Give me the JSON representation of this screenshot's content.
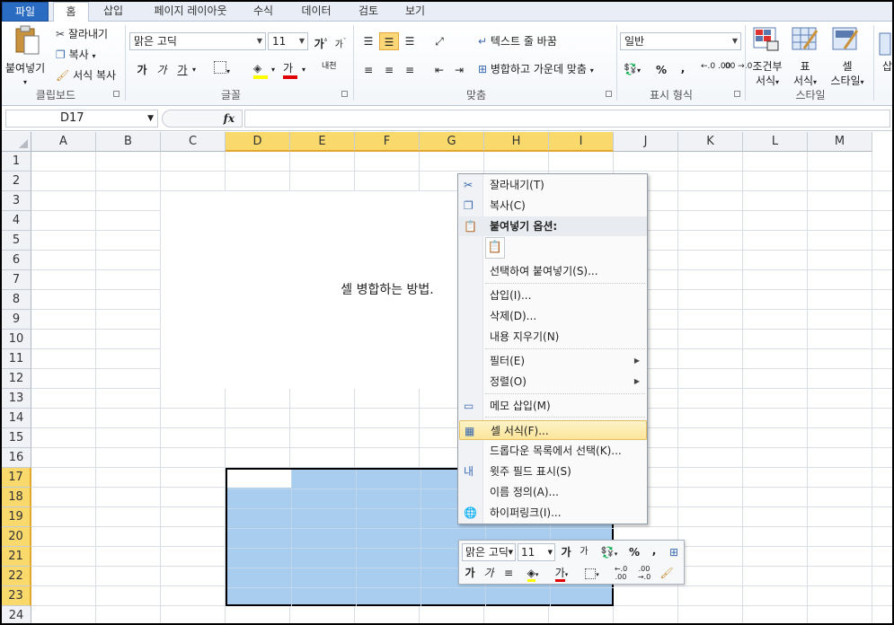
{
  "tabs": [
    "파일",
    "홈",
    "삽입",
    "페이지 레이아웃",
    "수식",
    "데이터",
    "검토",
    "보기"
  ],
  "ribbon": {
    "clipboard": {
      "paste": "붙여넣기",
      "cut": "잘라내기",
      "copy": "복사",
      "format_painter": "서식 복사",
      "group": "클립보드"
    },
    "font": {
      "name": "맑은 고딕",
      "size": "11",
      "grow": "가",
      "shrink": "가",
      "bold": "가",
      "italic": "가",
      "underline": "가",
      "color_a": "가",
      "phonetic": "내천",
      "group": "글꼴"
    },
    "alignment": {
      "wrap": "텍스트 줄 바꿈",
      "merge": "병합하고 가운데 맞춤",
      "group": "맞춤"
    },
    "number": {
      "format": "일반",
      "percent": "%",
      "comma": ",",
      "inc": "←.0 .00",
      "dec": ".00 →.0",
      "group": "표시 형식"
    },
    "styles": {
      "conditional_1": "조건부",
      "conditional_2": "서식",
      "table_1": "표",
      "table_2": "서식",
      "cell_1": "셀",
      "cell_2": "스타일",
      "group": "스타일"
    },
    "cells": {
      "insert": "삽"
    }
  },
  "formula_bar": {
    "name_box": "D17",
    "fx": "fx",
    "value": ""
  },
  "sheet": {
    "columns": [
      "A",
      "B",
      "C",
      "D",
      "E",
      "F",
      "G",
      "H",
      "I",
      "J",
      "K",
      "L",
      "M"
    ],
    "rows": [
      "1",
      "2",
      "3",
      "4",
      "5",
      "6",
      "7",
      "8",
      "9",
      "10",
      "11",
      "12",
      "13",
      "14",
      "15",
      "16",
      "17",
      "18",
      "19",
      "20",
      "21",
      "22",
      "23",
      "24"
    ],
    "merged_text": "셀 병합하는 방법."
  },
  "context_menu": {
    "items": [
      {
        "label": "잘라내기(T)",
        "icon": "scissors-icon"
      },
      {
        "label": "복사(C)",
        "icon": "copy-icon"
      },
      {
        "label": "붙여넣기 옵션:",
        "icon": "paste-icon"
      },
      {
        "label": "선택하여 붙여넣기(S)...",
        "icon": ""
      },
      {
        "label": "삽입(I)...",
        "icon": ""
      },
      {
        "label": "삭제(D)...",
        "icon": ""
      },
      {
        "label": "내용 지우기(N)",
        "icon": ""
      },
      {
        "label": "필터(E)",
        "icon": "",
        "submenu": true
      },
      {
        "label": "정렬(O)",
        "icon": "",
        "submenu": true
      },
      {
        "label": "메모 삽입(M)",
        "icon": "comment-icon"
      },
      {
        "label": "셀 서식(F)...",
        "icon": "format-cells-icon"
      },
      {
        "label": "드롭다운 목록에서 선택(K)...",
        "icon": ""
      },
      {
        "label": "윗주 필드 표시(S)",
        "icon": "phonetic-icon"
      },
      {
        "label": "이름 정의(A)...",
        "icon": ""
      },
      {
        "label": "하이퍼링크(I)...",
        "icon": "hyperlink-icon"
      }
    ]
  },
  "mini_toolbar": {
    "font": "맑은 고딕",
    "size": "11",
    "grow": "가",
    "shrink": "가",
    "percent": "%",
    "comma": ",",
    "bold": "가",
    "italic": "가",
    "color_a": "가",
    "inc": "←.0 .00",
    "dec": ".00 →.0"
  }
}
